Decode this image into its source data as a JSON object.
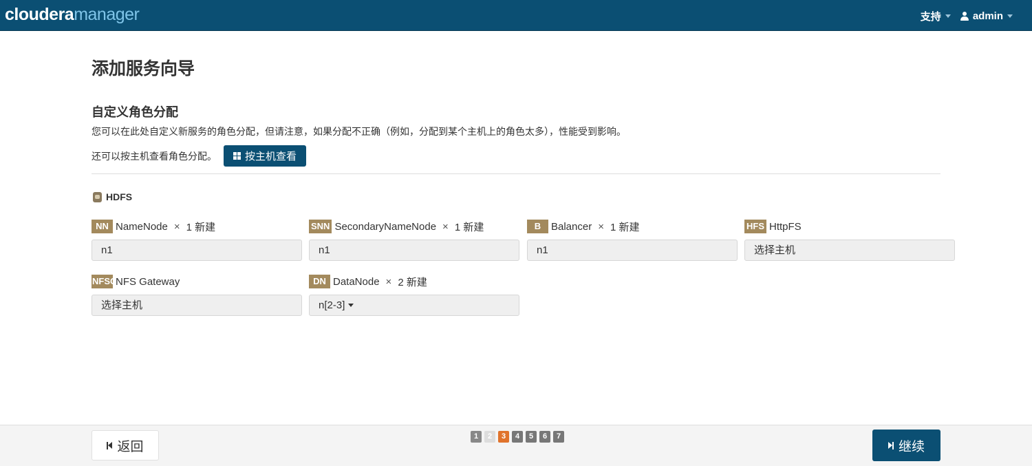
{
  "header": {
    "logo_part1": "cloudera",
    "logo_part2": "manager",
    "support_label": "支持",
    "user_label": "admin"
  },
  "page": {
    "title": "添加服务向导",
    "section_title": "自定义角色分配",
    "description": "您可以在此处自定义新服务的角色分配，但请注意，如果分配不正确（例如，分配到某个主机上的角色太多），性能受到影响。",
    "byhost_text": "还可以按主机查看角色分配。",
    "byhost_button": "按主机查看"
  },
  "service": {
    "name": "HDFS",
    "roles": [
      {
        "badge": "NN",
        "name": "NameNode",
        "times": "×",
        "count_label": "1 新建",
        "value": "n1"
      },
      {
        "badge": "SNN",
        "name": "SecondaryNameNode",
        "times": "×",
        "count_label": "1 新建",
        "value": "n1"
      },
      {
        "badge": "B",
        "name": "Balancer",
        "times": "×",
        "count_label": "1 新建",
        "value": "n1"
      },
      {
        "badge": "HFS",
        "name": "HttpFS",
        "value": "选择主机"
      },
      {
        "badge": "NFSG",
        "name": "NFS Gateway",
        "value": "选择主机"
      },
      {
        "badge": "DN",
        "name": "DataNode",
        "times": "×",
        "count_label": "2 新建",
        "value": "n[2-3]"
      }
    ]
  },
  "footer": {
    "back_label": "返回",
    "next_label": "继续",
    "steps": [
      "1",
      "2",
      "3",
      "4",
      "5",
      "6",
      "7"
    ],
    "active_step": "3"
  },
  "colors": {
    "brand": "#0b4f73",
    "accent_step": "#e0732c",
    "role_badge": "#a38a5d"
  }
}
